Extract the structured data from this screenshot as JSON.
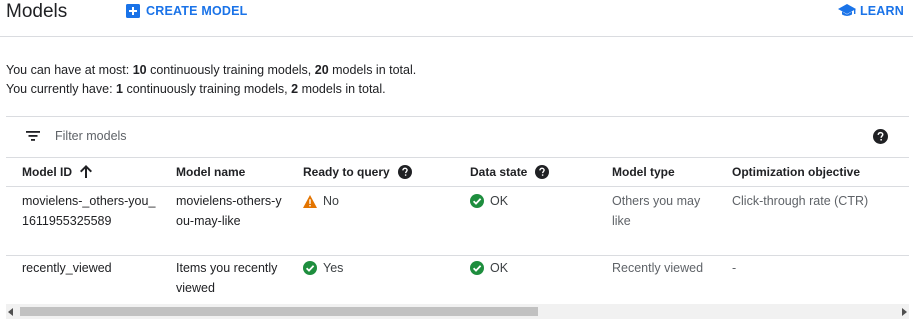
{
  "header": {
    "title": "Models",
    "create_label": "CREATE MODEL",
    "learn_label": "LEARN",
    "accent_color": "#1a73e8"
  },
  "quota": {
    "line1_prefix": "You can have at most: ",
    "line1_max_continuous": "10",
    "line1_mid": " continuously training models, ",
    "line1_max_total": "20",
    "line1_suffix": " models in total.",
    "line2_prefix": "You currently have: ",
    "line2_continuous": "1",
    "line2_mid": " continuously training models, ",
    "line2_total": "2",
    "line2_suffix": " models in total."
  },
  "filter": {
    "placeholder": "Filter models",
    "icon": "filter-list-icon",
    "help_icon": "help-icon"
  },
  "table": {
    "columns": [
      "Model ID",
      "Model name",
      "Ready to query",
      "Data state",
      "Model type",
      "Optimization objective"
    ],
    "rows": [
      {
        "model_id": "movielens-_others-you_1611955325589",
        "model_name": "movielens-others-you-may-like",
        "ready": "No",
        "ready_icon": "warning-icon",
        "data_state": "OK",
        "data_state_icon": "check-circle-icon",
        "model_type": "Others you may like",
        "objective": "Click-through rate (CTR)"
      },
      {
        "model_id": "recently_viewed",
        "model_name": "Items you recently viewed",
        "ready": "Yes",
        "ready_icon": "check-circle-icon",
        "data_state": "OK",
        "data_state_icon": "check-circle-icon",
        "model_type": "Recently viewed",
        "objective": "-"
      }
    ]
  },
  "colors": {
    "ok_green": "#1e8e3e",
    "warning_orange": "#e37400"
  }
}
